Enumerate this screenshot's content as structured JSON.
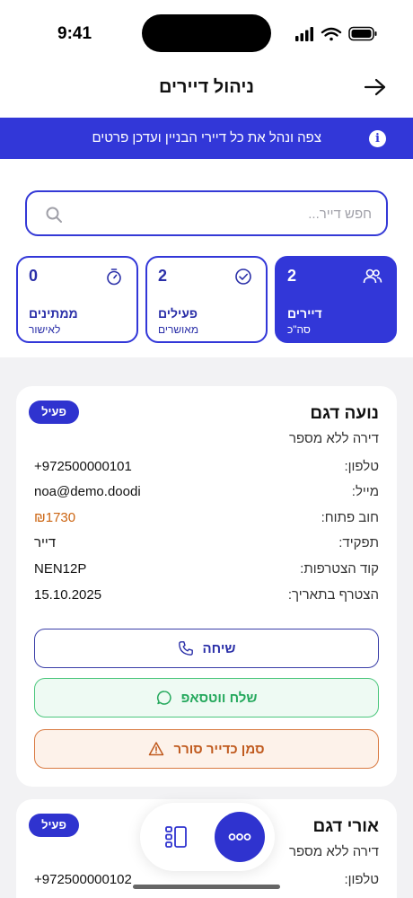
{
  "status_bar": {
    "time": "9:41"
  },
  "header": {
    "title": "ניהול דיירים"
  },
  "banner": {
    "text": "צפה ונהל את כל דיירי הבניין ועדכן פרטים"
  },
  "search": {
    "placeholder": "חפש דייר..."
  },
  "stats": [
    {
      "value": "2",
      "label": "דיירים",
      "sub": "סה\"כ",
      "active": true
    },
    {
      "value": "2",
      "label": "פעילים",
      "sub": "מאושרים",
      "active": false
    },
    {
      "value": "0",
      "label": "ממתינים",
      "sub": "לאישור",
      "active": false
    }
  ],
  "tenants": [
    {
      "name": "נועה דגם",
      "apartment": "דירה ללא מספר",
      "status": "פעיל",
      "fields": [
        {
          "label": "טלפון:",
          "value": "+972500000101"
        },
        {
          "label": "מייל:",
          "value": "noa@demo.doodi"
        },
        {
          "label": "חוב פתוח:",
          "value": "₪1730"
        },
        {
          "label": "תפקיד:",
          "value": "דייר"
        },
        {
          "label": "קוד הצטרפות:",
          "value": "NEN12P"
        },
        {
          "label": "הצטרף בתאריך:",
          "value": "15.10.2025"
        }
      ],
      "actions": {
        "call": "שיחה",
        "whatsapp": "שלח ווטסאפ",
        "flag": "סמן כדייר סורר"
      }
    },
    {
      "name": "אורי דגם",
      "apartment": "דירה ללא מספר",
      "status": "פעיל",
      "fields": [
        {
          "label": "טלפון:",
          "value": "+972500000102"
        }
      ]
    }
  ],
  "colors": {
    "primary": "#3237D8",
    "debt": "#CC6512",
    "whatsapp": "#24A85C",
    "flag": "#C05A1E"
  }
}
